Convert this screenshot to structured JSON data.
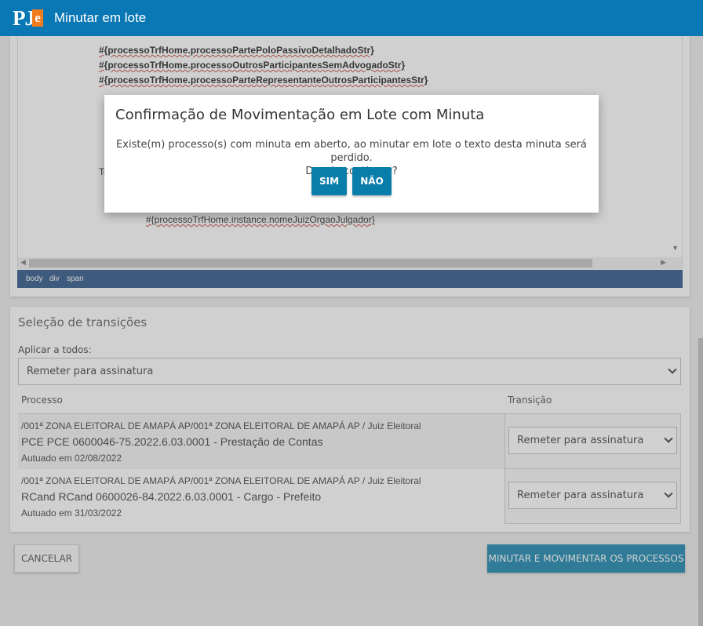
{
  "header": {
    "logo_text": "PJ",
    "logo_accent": "e",
    "title": "Minutar em lote"
  },
  "editor": {
    "lines": [
      "#{processoTrfHome.processoPartePoloPassivoDetalhadoStr}",
      "#{processoTrfHome.processoOutrosParticipantesSemAdvogadoStr}",
      "#{processoTrfHome.processoParteRepresentanteOutrosParticipantesStr}"
    ],
    "partial_text": "Te",
    "judge_line": "#{processoTrfHome.instance.nomeJuizOrgaoJulgador}",
    "path": [
      "body",
      "div",
      "span"
    ]
  },
  "modal": {
    "title": "Confirmação de Movimentação em Lote com Minuta",
    "message_line1": "Existe(m) processo(s) com minuta em aberto, ao minutar em lote o texto desta minuta será perdido.",
    "message_line2": "Deseja continuar?",
    "yes_label": "SIM",
    "no_label": "NÃO"
  },
  "transitions": {
    "section_title": "Seleção de transições",
    "apply_all_label": "Aplicar a todos:",
    "apply_all_value": "Remeter para assinatura",
    "col_processo": "Processo",
    "col_transicao": "Transição",
    "rows": [
      {
        "orgao": "/001ª ZONA ELEITORAL DE AMAPÁ AP/001ª ZONA ELEITORAL DE AMAPÁ AP / Juiz Eleitoral",
        "numero": "PCE PCE 0600046-75.2022.6.03.0001 - Prestação de Contas",
        "autuado": "Autuado em 02/08/2022",
        "transicao": "Remeter para assinatura"
      },
      {
        "orgao": "/001ª ZONA ELEITORAL DE AMAPÁ AP/001ª ZONA ELEITORAL DE AMAPÁ AP / Juiz Eleitoral",
        "numero": "RCand RCand 0600026-84.2022.6.03.0001 - Cargo - Prefeito",
        "autuado": "Autuado em 31/03/2022",
        "transicao": "Remeter para assinatura"
      }
    ]
  },
  "actions": {
    "cancel_label": "CANCELAR",
    "submit_label": "MINUTAR E MOVIMENTAR OS PROCESSOS"
  },
  "colors": {
    "brand": "#0a78b4",
    "accent": "#f07c1e",
    "primary_button": "#0a7eaa",
    "statusbar": "#1f4b7e"
  }
}
